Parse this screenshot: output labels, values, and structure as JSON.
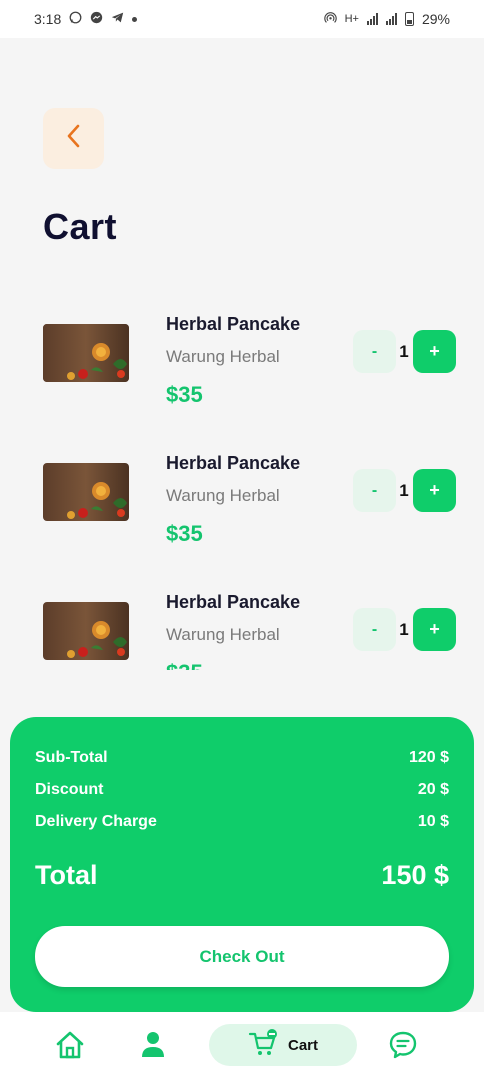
{
  "status_bar": {
    "time": "3:18",
    "network": "H+",
    "battery": "29%"
  },
  "header": {
    "back_icon": "chevron-left-icon",
    "title": "Cart"
  },
  "cart": {
    "items": [
      {
        "name": "Herbal Pancake",
        "vendor": "Warung Herbal",
        "price": "$35",
        "quantity": "1",
        "minus": "-",
        "plus": "+"
      },
      {
        "name": "Herbal Pancake",
        "vendor": "Warung Herbal",
        "price": "$35",
        "quantity": "1",
        "minus": "-",
        "plus": "+"
      },
      {
        "name": "Herbal Pancake",
        "vendor": "Warung Herbal",
        "price": "$35",
        "quantity": "1",
        "minus": "-",
        "plus": "+"
      }
    ]
  },
  "summary": {
    "subtotal_label": "Sub-Total",
    "subtotal_value": "120 $",
    "discount_label": "Discount",
    "discount_value": "20 $",
    "delivery_label": "Delivery Charge",
    "delivery_value": "10 $",
    "total_label": "Total",
    "total_value": "150 $",
    "checkout_label": "Check Out"
  },
  "nav": {
    "items": [
      "home-icon",
      "profile-icon",
      "cart-icon",
      "chat-icon"
    ],
    "active_label": "Cart"
  },
  "colors": {
    "accent": "#0fcd6a",
    "price": "#14c46e",
    "back_bg": "#fbeee0",
    "back_icon": "#e8741f"
  }
}
